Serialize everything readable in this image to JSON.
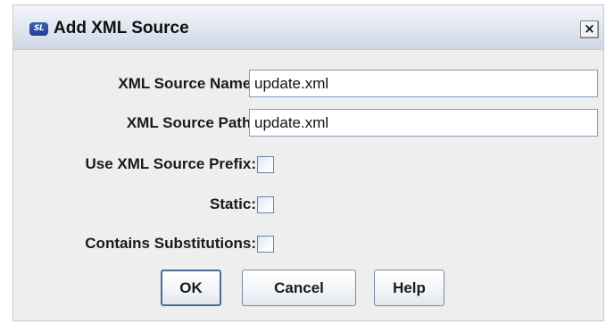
{
  "window": {
    "title": "Add XML Source",
    "app_icon_text": "SL",
    "close_glyph": "×"
  },
  "form": {
    "source_name": {
      "label": "XML Source Name:",
      "value": "update.xml"
    },
    "source_path": {
      "label": "XML Source Path:",
      "value": "update.xml"
    },
    "use_prefix": {
      "label": "Use XML Source Prefix:",
      "checked": false
    },
    "static": {
      "label": "Static:",
      "checked": false
    },
    "contains_substitutions": {
      "label": "Contains Substitutions:",
      "checked": false
    }
  },
  "buttons": {
    "ok": "OK",
    "cancel": "Cancel",
    "help": "Help"
  },
  "icons": {
    "app": "sl-logo-icon",
    "close": "close-icon"
  },
  "colors": {
    "field_border": "#7f9db9",
    "dialog_background": "#eeeeee"
  }
}
